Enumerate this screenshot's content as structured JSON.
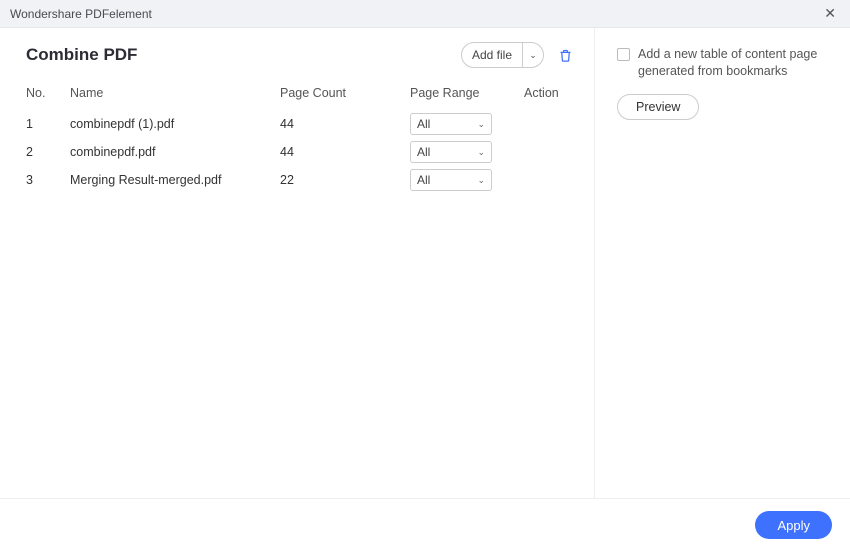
{
  "app_title": "Wondershare PDFelement",
  "dialog": {
    "title": "Combine PDF",
    "add_file_label": "Add file",
    "columns": {
      "no": "No.",
      "name": "Name",
      "page_count": "Page Count",
      "page_range": "Page Range",
      "action": "Action"
    },
    "page_range_default": "All",
    "rows": [
      {
        "no": "1",
        "name": "combinepdf (1).pdf",
        "page_count": "44",
        "page_range": "All"
      },
      {
        "no": "2",
        "name": "combinepdf.pdf",
        "page_count": "44",
        "page_range": "All"
      },
      {
        "no": "3",
        "name": "Merging Result-merged.pdf",
        "page_count": "22",
        "page_range": "All"
      }
    ]
  },
  "side": {
    "toc_checkbox_label": "Add a new table of content page generated from bookmarks",
    "preview_label": "Preview"
  },
  "footer": {
    "apply_label": "Apply"
  }
}
